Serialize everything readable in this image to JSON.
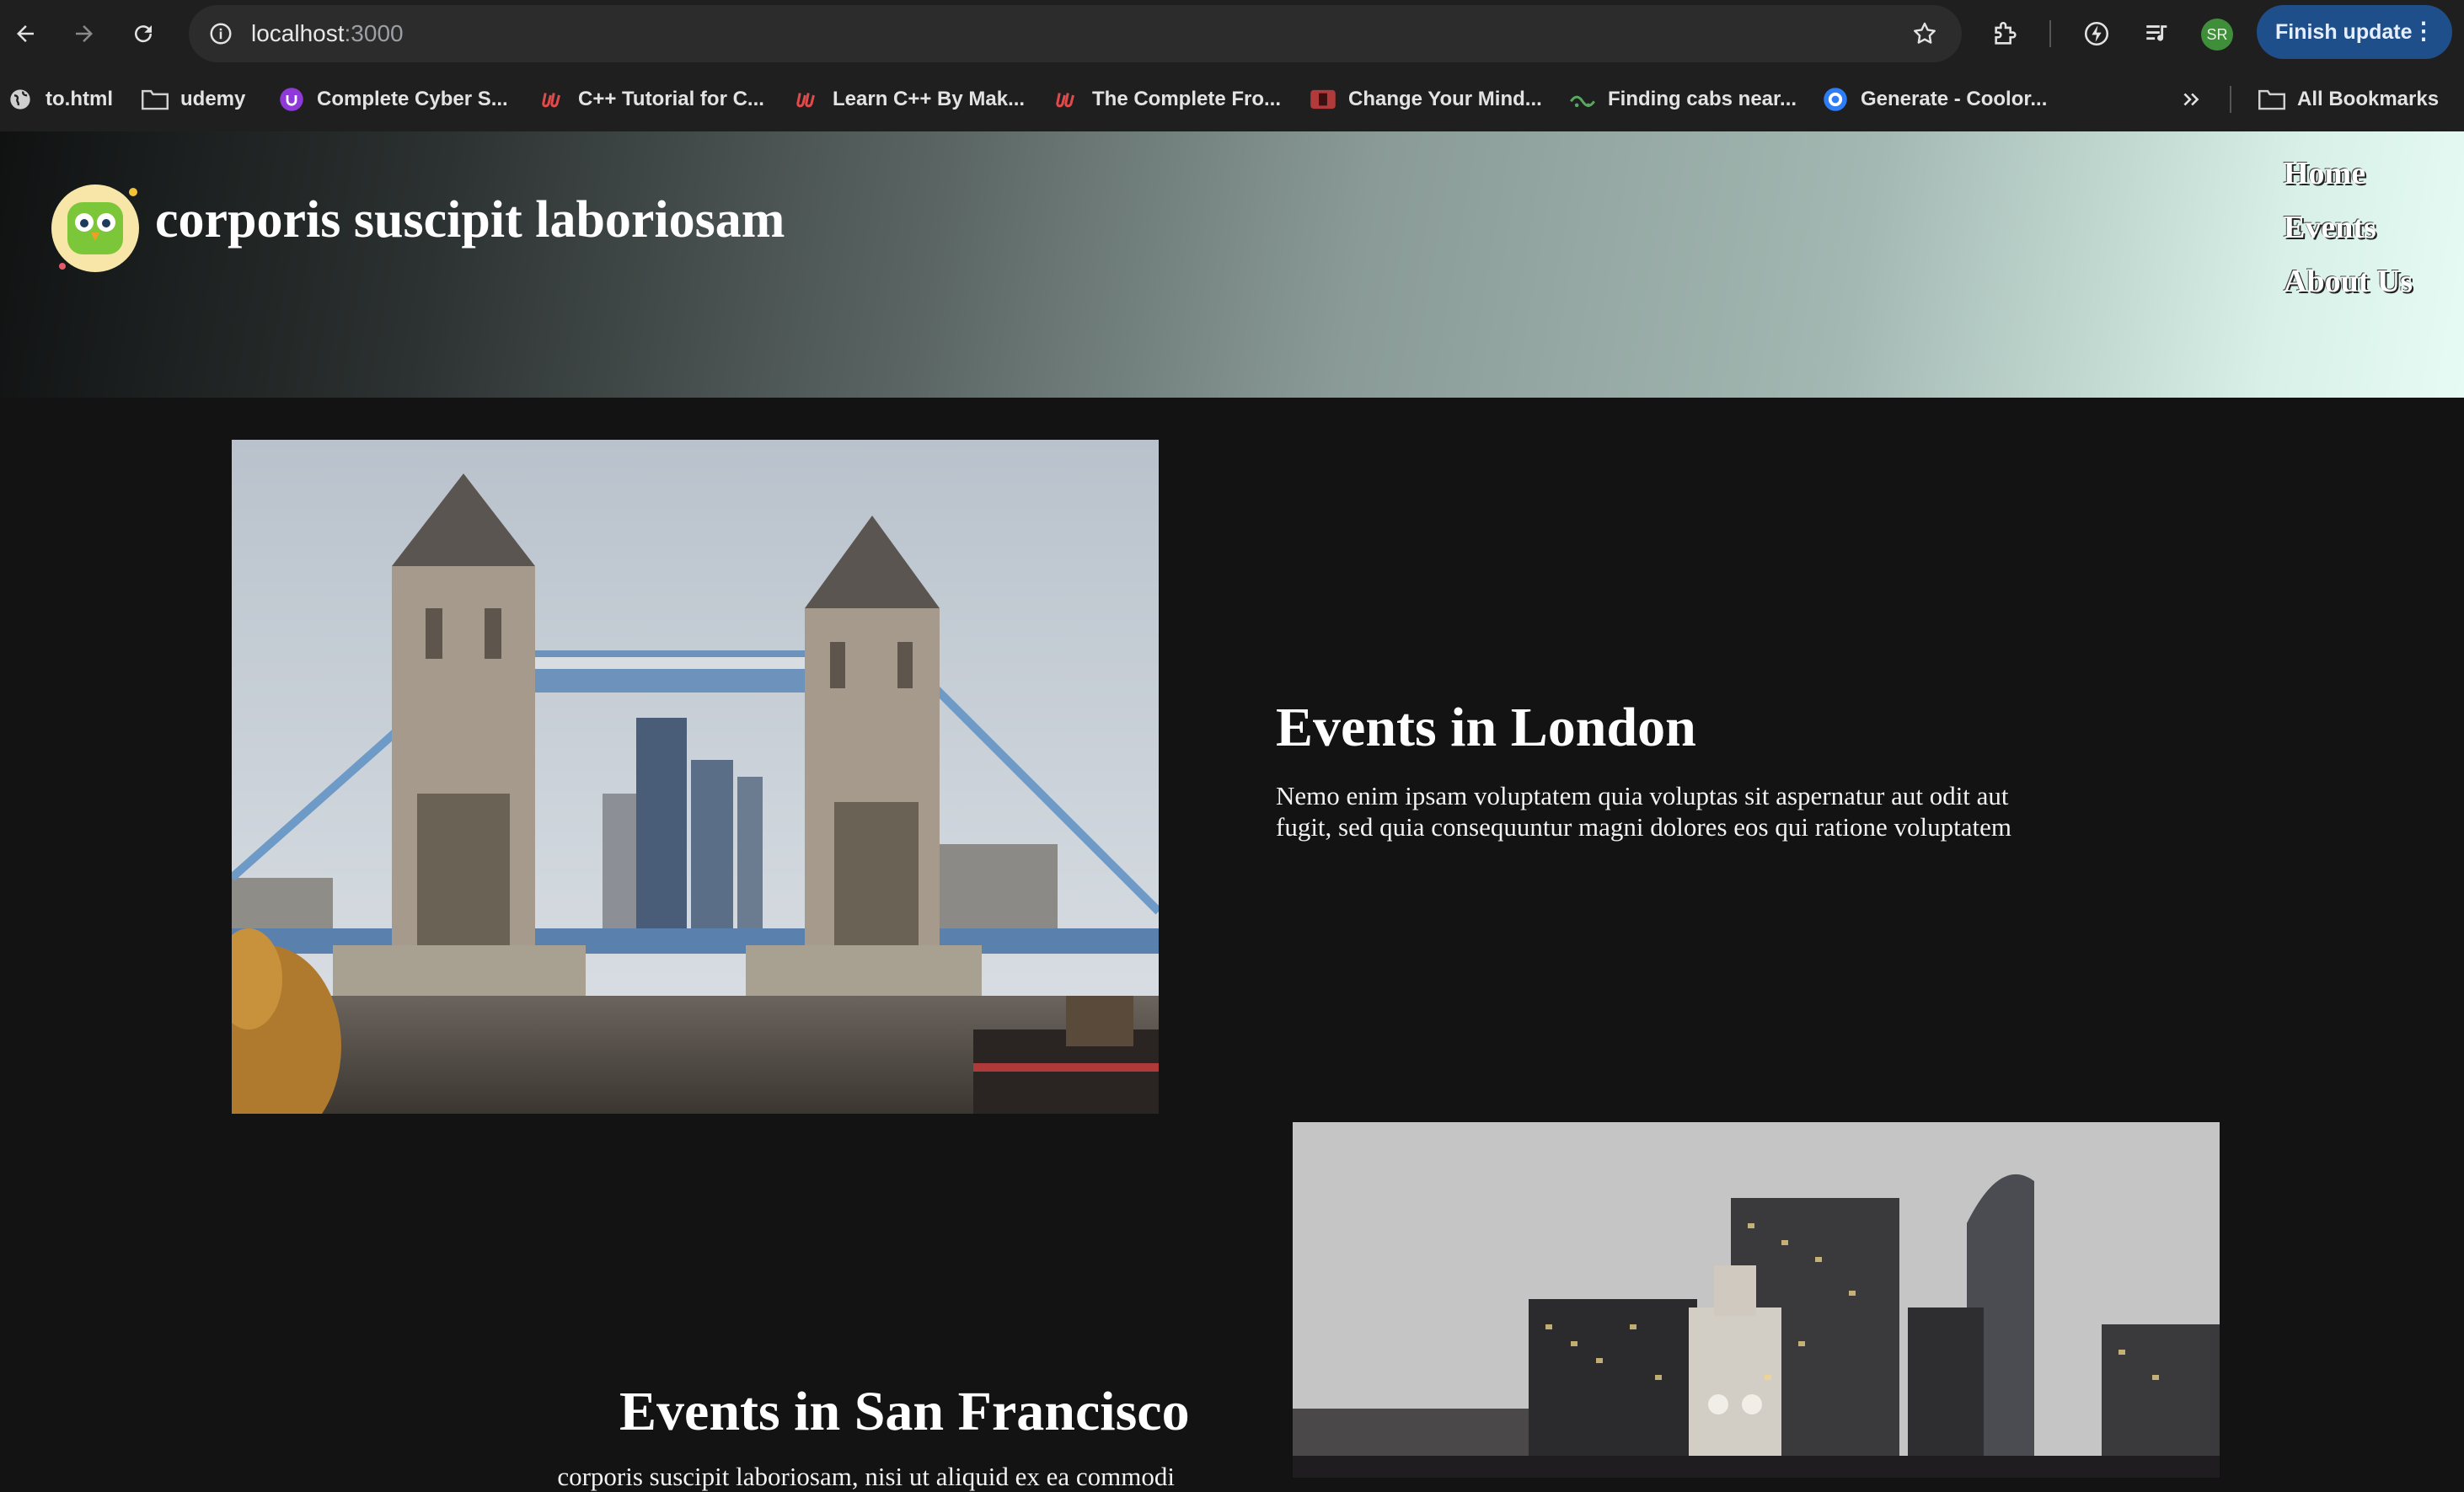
{
  "browser": {
    "url_host": "localhost",
    "url_port": ":3000",
    "profile_initials": "SR",
    "update_label": "Finish update"
  },
  "bookmarks": [
    {
      "label": "to.html",
      "icon": "globe-icon"
    },
    {
      "label": "udemy",
      "icon": "folder-icon"
    },
    {
      "label": "Complete Cyber S...",
      "icon": "udemy-icon"
    },
    {
      "label": "C++ Tutorial for C...",
      "icon": "udemy-u-icon"
    },
    {
      "label": "Learn C++ By Mak...",
      "icon": "udemy-u-icon"
    },
    {
      "label": "The Complete Fro...",
      "icon": "udemy-u-icon"
    },
    {
      "label": "Change Your Mind...",
      "icon": "video-icon"
    },
    {
      "label": "Finding cabs near...",
      "icon": "cab-icon"
    },
    {
      "label": "Generate - Coolor...",
      "icon": "coolors-icon"
    }
  ],
  "all_bookmarks_label": "All Bookmarks",
  "site": {
    "brand": "corporis suscipit laboriosam",
    "nav": [
      "Home",
      "Events",
      "About Us"
    ]
  },
  "events": [
    {
      "title": "Events in London",
      "description": "Nemo enim ipsam voluptatem quia voluptas sit aspernatur aut odit aut fugit, sed quia consequuntur magni dolores eos qui ratione voluptatem",
      "photo": "tower-bridge-photo"
    },
    {
      "title": "Events in San Francisco",
      "description": "corporis suscipit laboriosam, nisi ut aliquid ex ea commodi",
      "photo": "san-francisco-skyline-photo"
    }
  ],
  "colors": {
    "page_bg": "#131313",
    "chrome_bg": "#1f1f1f",
    "update_button": "#1f4f8a",
    "header_gradient_end": "#e6fbf3"
  }
}
